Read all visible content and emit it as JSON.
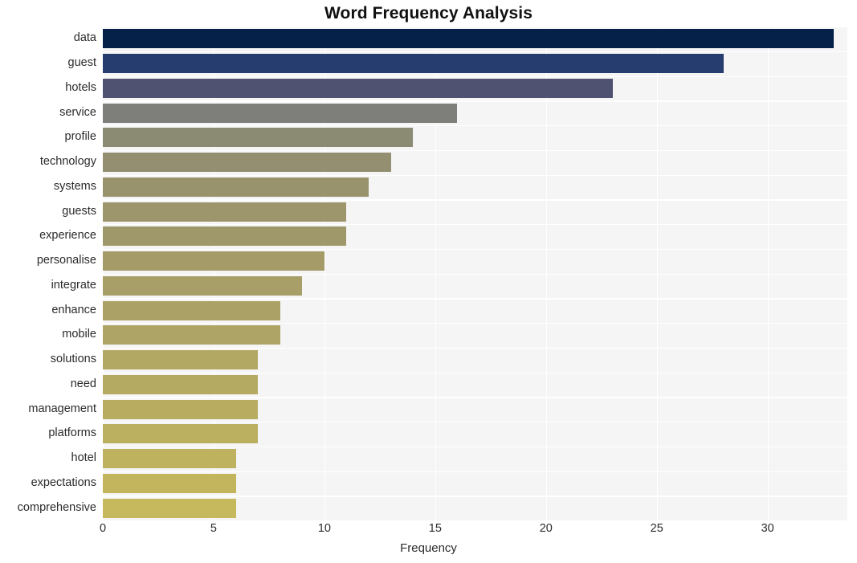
{
  "chart_data": {
    "type": "bar",
    "orientation": "horizontal",
    "title": "Word Frequency Analysis",
    "xlabel": "Frequency",
    "ylabel": "",
    "categories": [
      "data",
      "guest",
      "hotels",
      "service",
      "profile",
      "technology",
      "systems",
      "guests",
      "experience",
      "personalise",
      "integrate",
      "enhance",
      "mobile",
      "solutions",
      "need",
      "management",
      "platforms",
      "hotel",
      "expectations",
      "comprehensive"
    ],
    "values": [
      33,
      28,
      23,
      16,
      14,
      13,
      12,
      11,
      11,
      10,
      9,
      8,
      8,
      7,
      7,
      7,
      7,
      6,
      6,
      6
    ],
    "bar_colors": [
      "#052149",
      "#263d6f",
      "#4f5371",
      "#7e7e7a",
      "#8b8a72",
      "#938f70",
      "#99936d",
      "#9d966c",
      "#9f986b",
      "#a49b69",
      "#a79e68",
      "#ab a166",
      "#aea465",
      "#b2a763",
      "#b5aa62",
      "#b8ac61",
      "#bbaf60",
      "#bfb25f",
      "#c2b55e",
      "#c6b85d"
    ],
    "xlim": [
      0,
      33.6
    ],
    "xticks": [
      0,
      5,
      10,
      15,
      20,
      25,
      30
    ],
    "xticklabels": [
      "0",
      "5",
      "10",
      "15",
      "20",
      "25",
      "30"
    ],
    "grid": true,
    "grid_color": "#ffffff",
    "plot_background": "#f5f5f6",
    "figure_background": "#ffffff",
    "legend": null
  }
}
